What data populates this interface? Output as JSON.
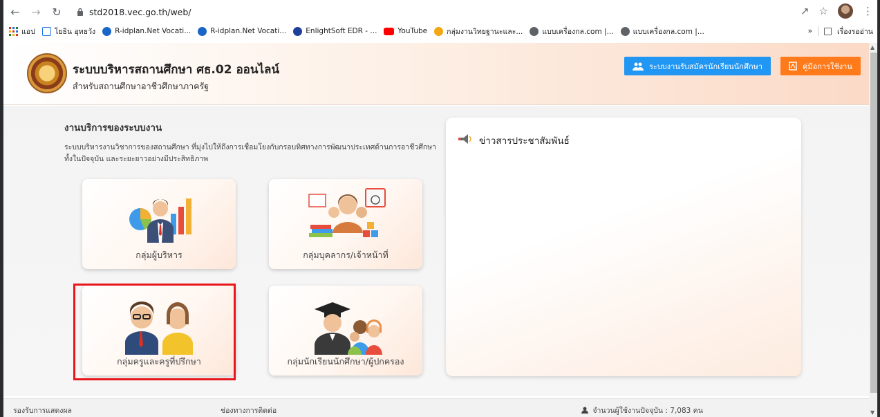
{
  "browser": {
    "url": "std2018.vec.go.th/web/",
    "bookmarks": [
      {
        "label": "แอป",
        "icon": "apps-icon",
        "color": "#d93025"
      },
      {
        "label": "โยธิน อุทธวัง",
        "icon": "sheet-icon",
        "color": "#1a73e8"
      },
      {
        "label": "R-idplan.Net Vocati...",
        "icon": "r-idplan-icon",
        "color": "#1a66c8"
      },
      {
        "label": "R-idplan.Net Vocati...",
        "icon": "r-idplan-icon",
        "color": "#1a66c8"
      },
      {
        "label": "EnlightSoft EDR - ...",
        "icon": "edr-icon",
        "color": "#1f3f9b"
      },
      {
        "label": "YouTube",
        "icon": "youtube-icon",
        "color": "#ff0000"
      },
      {
        "label": "กลุ่มงานวิทยฐานะและ...",
        "icon": "circle-icon",
        "color": "#f3a712"
      },
      {
        "label": "แบบเครื่องกล.com |...",
        "icon": "globe-icon",
        "color": "#5f6368"
      },
      {
        "label": "แบบเครื่องกล.com |...",
        "icon": "globe-icon",
        "color": "#5f6368"
      }
    ],
    "bookmarks_more": "»",
    "reading_list": "เรื่องรออ่าน"
  },
  "header": {
    "title": "ระบบบริหารสถานศึกษา ศธ.02 ออนไลน์",
    "subtitle": "สำหรับสถานศึกษาอาชีวศึกษาภาครัฐ",
    "register_button": "ระบบงานรับสมัครนักเรียนนักศึกษา",
    "manual_button": "คู่มือการใช้งาน",
    "register_color": "#2196f3",
    "manual_color": "#ff7a1a"
  },
  "main": {
    "section_title": "งานบริการของระบบงาน",
    "section_desc": "ระบบบริหารงานวิชาการของสถานศึกษา ที่มุ่งไปให้ถึงการเชื่อมโยงกับกรอบทิศทางการพัฒนาประเทศด้านการอาชีวศึกษาทั้งในปัจจุบัน และระยะยาวอย่างมีประสิทธิภาพ",
    "cards": [
      {
        "label": "กลุ่มผู้บริหาร",
        "icon": "executive-icon"
      },
      {
        "label": "กลุ่มบุคลากร/เจ้าหน้าที่",
        "icon": "staff-icon"
      },
      {
        "label": "กลุ่มครูและครูที่ปรึกษา",
        "icon": "teacher-icon"
      },
      {
        "label": "กลุ่มนักเรียนนักศึกษา/ผู้ปกครอง",
        "icon": "student-icon"
      }
    ],
    "news_title": "ข่าวสารประชาสัมพันธ์"
  },
  "footer": {
    "left": "รองรับการแสดงผล",
    "middle": "ช่องทางการติดต่อ",
    "users_label": "จำนวนผู้ใช้งานปัจจุบัน : 7,083 คน"
  }
}
